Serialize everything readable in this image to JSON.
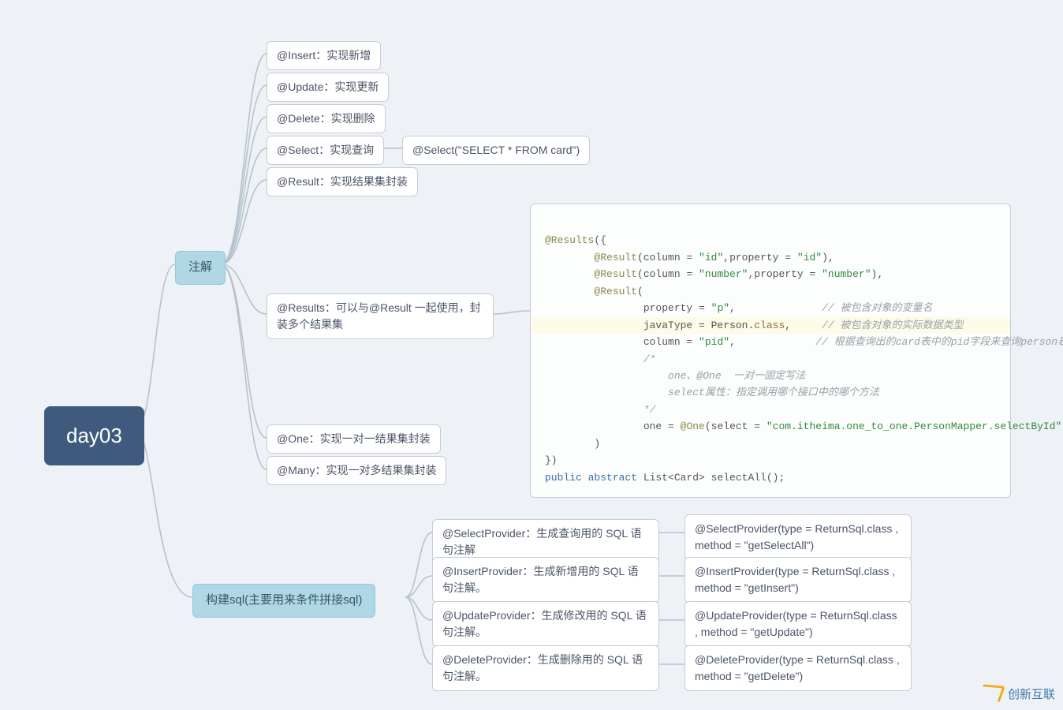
{
  "root": {
    "label": "day03"
  },
  "branches": {
    "annotations": {
      "label": "注解",
      "items": {
        "insert": "@Insert：实现新增",
        "update": "@Update：实现更新",
        "delete": "@Delete：实现删除",
        "select": "@Select：实现查询",
        "select_ex": "@Select(\"SELECT * FROM card\")",
        "result": "@Result：实现结果集封装",
        "results": "@Results：可以与@Result 一起使用，封装多个结果集",
        "one": "@One：实现一对一结果集封装",
        "many": "@Many：实现一对多结果集封装"
      },
      "code": {
        "l1": "@Results({",
        "l2": "        @Result(column = \"id\",property = \"id\"),",
        "l3": "        @Result(column = \"number\",property = \"number\"),",
        "l4": "        @Result(",
        "l5": "                property = \"p\",              // 被包含对象的变量名",
        "l6": "                javaType = Person.class,      // 被包含对象的实际数据类型",
        "l7": "                column = \"pid\",              // 根据查询出的card表中的pid字段来查询person表",
        "l8": "                /*",
        "l9": "                    one、@One  一对一固定写法",
        "l10": "                    select属性：指定调用哪个接口中的哪个方法",
        "l11": "                */",
        "l12": "                one = @One(select = \"com.itheima.one_to_one.PersonMapper.selectById\")",
        "l13": "        )",
        "l14": "})",
        "l15": "public abstract List<Card> selectAll();"
      }
    },
    "build_sql": {
      "label": "构建sql(主要用来条件拼接sql)",
      "items": {
        "select_p": "@SelectProvider：生成查询用的 SQL 语句注解",
        "select_p_ex": "@SelectProvider(type = ReturnSql.class , method = \"getSelectAll\")",
        "insert_p": "@InsertProvider：生成新增用的 SQL 语句注解。",
        "insert_p_ex": "@InsertProvider(type = ReturnSql.class , method = \"getInsert\")",
        "update_p": "@UpdateProvider：生成修改用的 SQL 语句注解。",
        "update_p_ex": " @UpdateProvider(type = ReturnSql.class , method = \"getUpdate\")",
        "delete_p": "@DeleteProvider：生成删除用的 SQL 语句注解。",
        "delete_p_ex": "@DeleteProvider(type = ReturnSql.class , method = \"getDelete\")"
      }
    }
  },
  "watermark": "创新互联"
}
